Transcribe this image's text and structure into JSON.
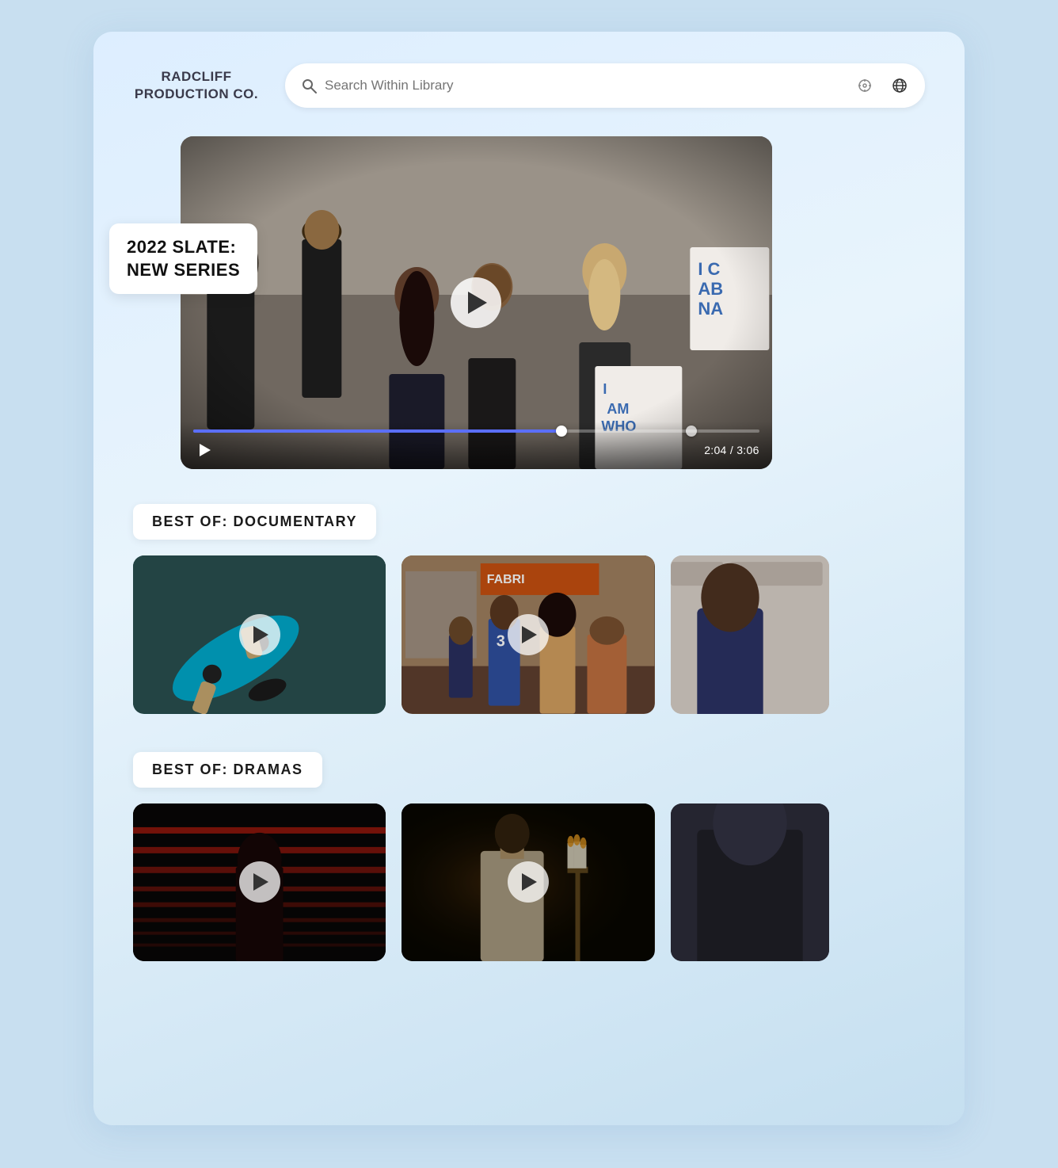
{
  "app": {
    "logo_line1": "RADCLIFF",
    "logo_line2": "PRODUCTION CO."
  },
  "search": {
    "placeholder": "Search Within Library"
  },
  "featured": {
    "label_line1": "2022 SLATE:",
    "label_line2": "NEW SERIES",
    "time_current": "2:04",
    "time_total": "3:06",
    "time_display": "2:04 / 3:06",
    "progress_percent": 66
  },
  "sections": [
    {
      "id": "documentary",
      "label": "BEST OF: DOCUMENTARY",
      "videos": [
        {
          "id": "skate",
          "thumb_class": "thumb-skate"
        },
        {
          "id": "street",
          "thumb_class": "thumb-street"
        },
        {
          "id": "partial",
          "thumb_class": "thumb-partial"
        }
      ]
    },
    {
      "id": "dramas",
      "label": "BEST OF: DRAMAS",
      "videos": [
        {
          "id": "stage",
          "thumb_class": "thumb-stage"
        },
        {
          "id": "candles",
          "thumb_class": "thumb-candles"
        },
        {
          "id": "dark3",
          "thumb_class": "thumb-dark"
        }
      ]
    }
  ],
  "icons": {
    "search": "🔍",
    "crosshair": "◎",
    "globe": "🌐",
    "play": "▶"
  }
}
